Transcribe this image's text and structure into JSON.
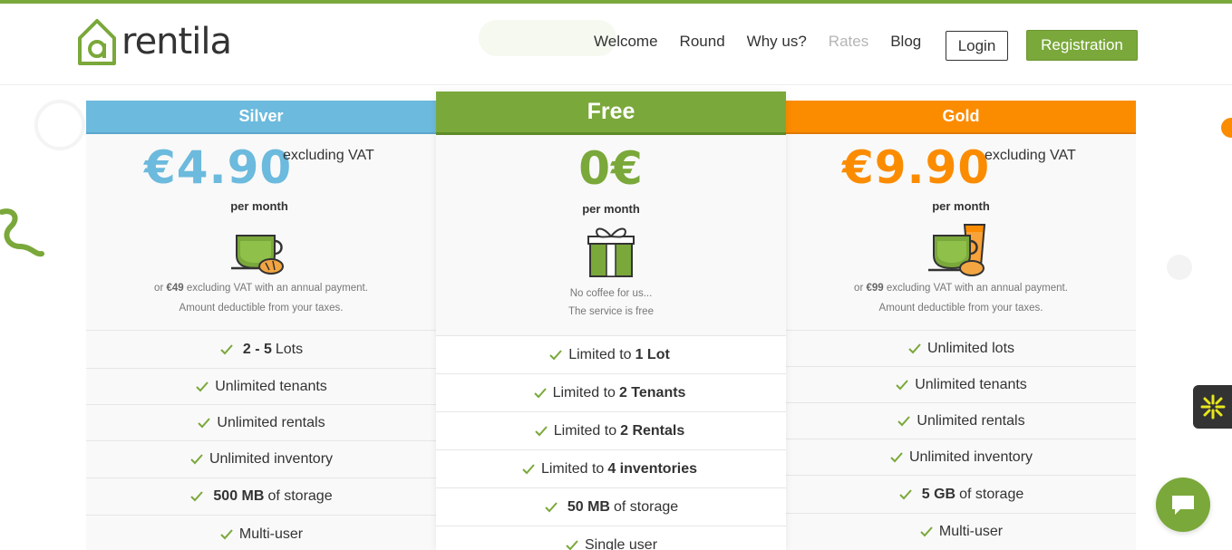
{
  "brand": {
    "name": "rentila",
    "accent": "#7aa83a"
  },
  "nav": {
    "items": [
      "Welcome",
      "Round",
      "Why us?",
      "Rates",
      "Blog"
    ],
    "login": "Login",
    "register": "Registration"
  },
  "plans": {
    "silver": {
      "name": "Silver",
      "color": "#6cbadd",
      "price": "€4.90",
      "vat": "excluding VAT",
      "period": "per month",
      "note_pre": "or ",
      "note_amount": "€49",
      "note_post": " excluding VAT with an annual payment.",
      "note2": "Amount deductible from your taxes.",
      "icon": "coffee-cup-icon",
      "features": [
        {
          "pre": "",
          "bold": "2 - 5",
          "post": "Lots"
        },
        {
          "pre": "Unlimited tenants",
          "bold": "",
          "post": ""
        },
        {
          "pre": "Unlimited rentals",
          "bold": "",
          "post": ""
        },
        {
          "pre": "Unlimited inventory",
          "bold": "",
          "post": ""
        },
        {
          "pre": "",
          "bold": "500 MB",
          "post": "of storage"
        },
        {
          "pre": "Multi-user",
          "bold": "",
          "post": ""
        }
      ]
    },
    "free": {
      "name": "Free",
      "color": "#7aa83a",
      "price": "0€",
      "period": "per month",
      "note1": "No coffee for us...",
      "note2": "The service is free",
      "icon": "gift-icon",
      "features": [
        {
          "pre": "Limited to",
          "bold": "1 Lot",
          "post": ""
        },
        {
          "pre": "Limited to",
          "bold": "2 Tenants",
          "post": ""
        },
        {
          "pre": "Limited to",
          "bold": "2 Rentals",
          "post": ""
        },
        {
          "pre": "Limited to",
          "bold": "4 inventories",
          "post": ""
        },
        {
          "pre": "",
          "bold": "50 MB",
          "post": "of storage"
        },
        {
          "pre": "Single user",
          "bold": "",
          "post": ""
        }
      ]
    },
    "gold": {
      "name": "Gold",
      "color": "#fb8c00",
      "price": "€9.90",
      "vat": "excluding VAT",
      "period": "per month",
      "note_pre": "or ",
      "note_amount": "€99",
      "note_post": " excluding VAT with an annual payment.",
      "note2": "Amount deductible from your taxes.",
      "icon": "coffee-and-juice-icon",
      "features": [
        {
          "pre": "Unlimited lots",
          "bold": "",
          "post": ""
        },
        {
          "pre": "Unlimited tenants",
          "bold": "",
          "post": ""
        },
        {
          "pre": "Unlimited rentals",
          "bold": "",
          "post": ""
        },
        {
          "pre": "Unlimited inventory",
          "bold": "",
          "post": ""
        },
        {
          "pre": "",
          "bold": "5 GB",
          "post": "of storage"
        },
        {
          "pre": "Multi-user",
          "bold": "",
          "post": ""
        }
      ]
    }
  }
}
